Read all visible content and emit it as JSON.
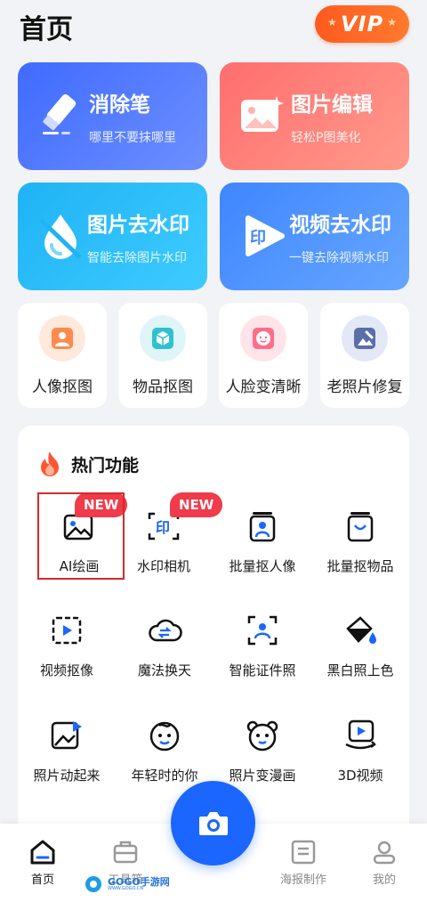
{
  "header": {
    "title": "首页",
    "vip_label": "VIP"
  },
  "cards": [
    {
      "title": "消除笔",
      "subtitle": "哪里不要抹哪里"
    },
    {
      "title": "图片编辑",
      "subtitle": "轻松P图美化"
    },
    {
      "title": "图片去水印",
      "subtitle": "智能去除图片水印"
    },
    {
      "title": "视频去水印",
      "subtitle": "一键去除视频水印"
    }
  ],
  "quick_tools": [
    {
      "label": "人像抠图",
      "icon": "portrait-cutout-icon"
    },
    {
      "label": "物品抠图",
      "icon": "object-cutout-icon"
    },
    {
      "label": "人脸变清晰",
      "icon": "face-enhance-icon"
    },
    {
      "label": "老照片修复",
      "icon": "photo-repair-icon"
    }
  ],
  "hot": {
    "title": "热门功能",
    "items": [
      {
        "label": "AI绘画",
        "badge": "NEW",
        "icon": "ai-painting-icon"
      },
      {
        "label": "水印相机",
        "badge": "NEW",
        "icon": "watermark-camera-icon"
      },
      {
        "label": "批量抠人像",
        "icon": "batch-portrait-icon"
      },
      {
        "label": "批量抠物品",
        "icon": "batch-object-icon"
      },
      {
        "label": "视频抠像",
        "icon": "video-cutout-icon"
      },
      {
        "label": "魔法换天",
        "icon": "sky-replace-icon"
      },
      {
        "label": "智能证件照",
        "icon": "id-photo-icon"
      },
      {
        "label": "黑白照上色",
        "icon": "colorize-icon"
      },
      {
        "label": "照片动起来",
        "icon": "animate-photo-icon"
      },
      {
        "label": "年轻时的你",
        "icon": "younger-face-icon"
      },
      {
        "label": "照片变漫画",
        "icon": "cartoon-icon"
      },
      {
        "label": "3D视频",
        "icon": "3d-video-icon"
      }
    ]
  },
  "tabbar": {
    "items": [
      {
        "label": "首页",
        "icon": "home-icon",
        "active": true
      },
      {
        "label": "工具箱",
        "icon": "toolbox-icon"
      },
      {
        "label": "海报制作",
        "icon": "poster-icon"
      },
      {
        "label": "我的",
        "icon": "profile-icon"
      }
    ],
    "camera_icon": "camera-icon"
  },
  "watermark": {
    "text": "GOGO手游网",
    "sub": "WWW.GOGO.CN"
  },
  "colors": {
    "primary": "#1a66ff",
    "vip": "#ff5a1f",
    "badge": "#ef3b4a",
    "highlight": "#d52a2a"
  }
}
